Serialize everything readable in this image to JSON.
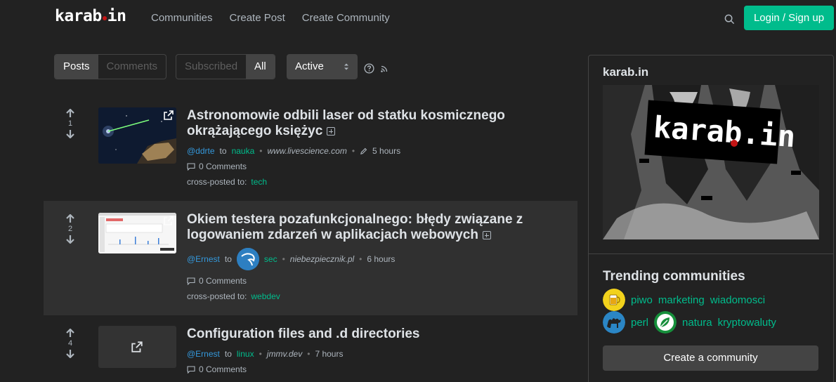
{
  "navbar": {
    "brand_prefix": "karab",
    "brand_suffix": "in",
    "links": [
      "Communities",
      "Create Post",
      "Create Community"
    ],
    "login_label": "Login / Sign up"
  },
  "filters": {
    "type_options": [
      "Posts",
      "Comments"
    ],
    "type_active": "Posts",
    "listing_options": [
      "Subscribed",
      "All"
    ],
    "listing_active": "All",
    "sort_selected": "Active"
  },
  "posts": [
    {
      "score": "1",
      "title": "Astronomowie odbili laser od statku kosmicznego okrążającego księżyc",
      "user": "@ddrte",
      "to": "to",
      "community": "nauka",
      "domain": "www.livescience.com",
      "time": "5 hours",
      "comments": "0 Comments",
      "cross_label": "cross-posted to:",
      "cross_community": "tech"
    },
    {
      "score": "2",
      "title": "Okiem testera pozafunkcjonalnego: błędy związane z logowaniem zdarzeń w aplikacjach webowych",
      "user": "@Ernest",
      "to": "to",
      "community": "sec",
      "domain": "niebezpiecznik.pl",
      "time": "6 hours",
      "comments": "0 Comments",
      "cross_label": "cross-posted to:",
      "cross_community": "webdev"
    },
    {
      "score": "4",
      "title": "Configuration files and .d directories",
      "user": "@Ernest",
      "to": "to",
      "community": "linux",
      "domain": "jmmv.dev",
      "time": "7 hours",
      "comments": "0 Comments"
    }
  ],
  "sidebar": {
    "title": "karab.in",
    "banner_prefix": "karab",
    "banner_suffix": "in",
    "trending_title": "Trending communities",
    "trending_row1": [
      "piwo",
      "marketing",
      "wiadomosci"
    ],
    "trending_row2": [
      "perl",
      "natura",
      "kryptowaluty"
    ],
    "create_label": "Create a community"
  },
  "colors": {
    "background": "#222222",
    "accent": "#00bc8c",
    "link": "#3498db"
  }
}
